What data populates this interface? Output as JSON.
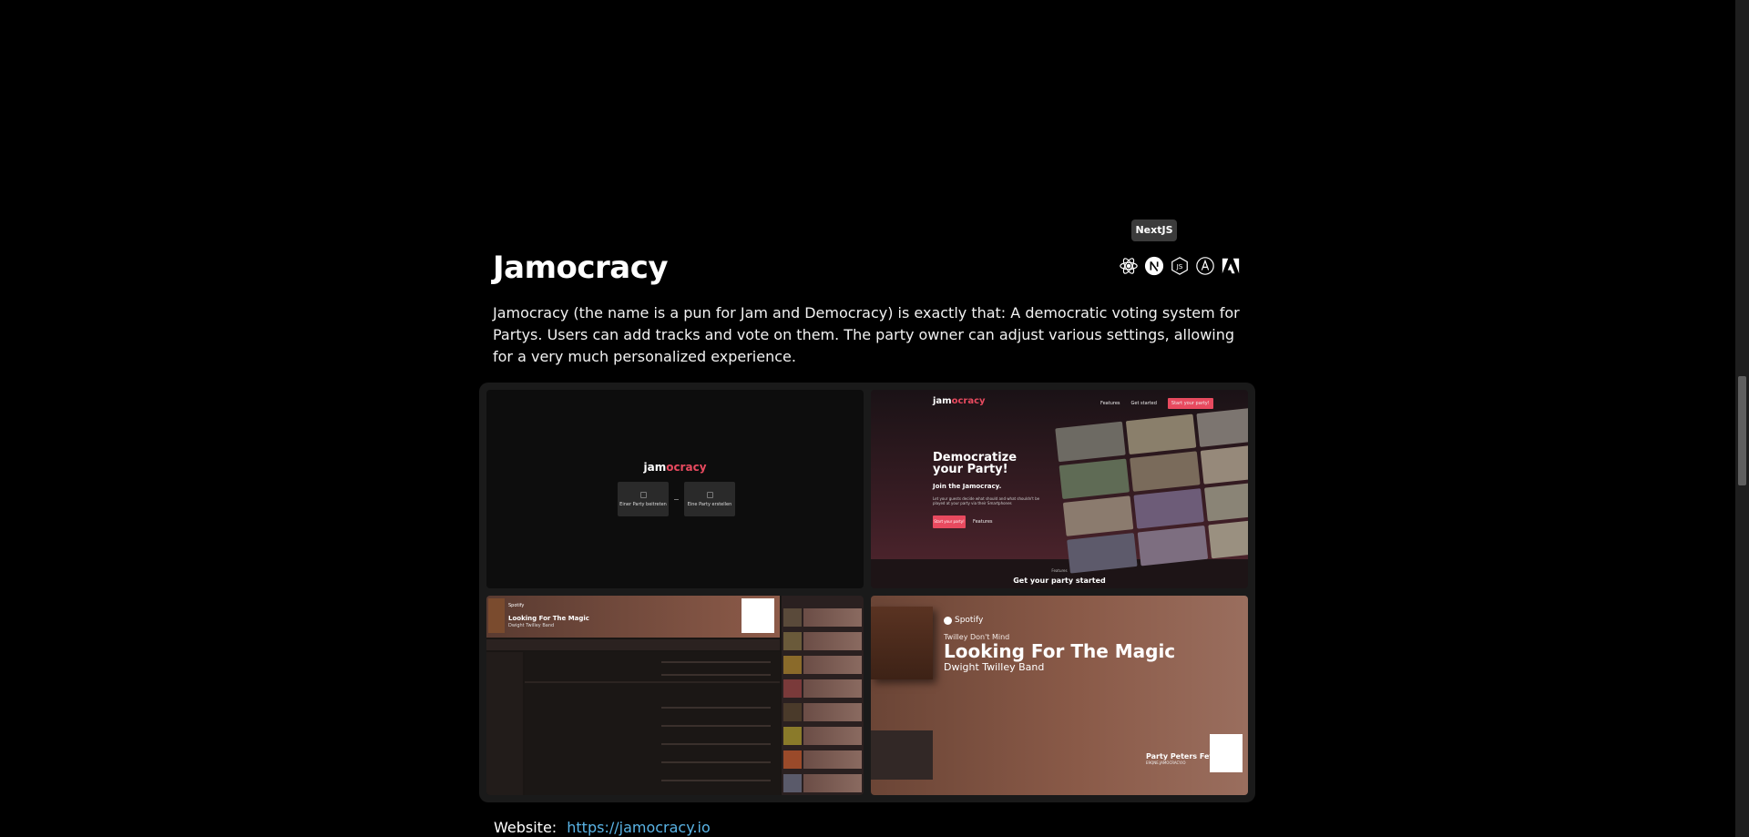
{
  "tooltip": "NextJS",
  "project": {
    "title": "Jamocracy",
    "description": "Jamocracy (the name is a pun for Jam and Democracy) is exactly that: A democratic voting system for Partys. Users can add tracks and vote on them. The party owner can adjust various settings, allowing for a very much personalized experience.",
    "website_label": "Website:",
    "website_url": "https://jamocracy.io"
  },
  "tech_icons": [
    "react-icon",
    "nextjs-icon",
    "nodejs-icon",
    "angular-icon",
    "adobe-icon"
  ],
  "screens": {
    "join": {
      "logo_a": "jam",
      "logo_b": "ocracy",
      "card1": "Einer Party beitreten",
      "card2": "Eine Party erstellen"
    },
    "landing": {
      "logo_a": "jam",
      "logo_b": "ocracy",
      "nav": [
        "Features",
        "Get started",
        "Start your party!"
      ],
      "headline": "Democratize your Party!",
      "subheading": "Join the Jamocracy.",
      "body": "Let your guests decide what should and what shouldn't be played at your party via their Smartphones",
      "cta": "Start your party!",
      "secondary": "Features",
      "bottom_label": "Features",
      "bottom_heading": "Get your party started"
    },
    "dashboard": {
      "provider": "Spotify",
      "song": "Looking For The Magic",
      "artist": "Dwight Twilley Band"
    },
    "player": {
      "provider": "Spotify",
      "album": "Twilley Don't Mind",
      "song": "Looking For The Magic",
      "artist": "Dwight Twilley Band",
      "party_name": "Party Peters Fete",
      "party_code": "E9QNE.JAMOCRACY.IO"
    }
  },
  "colors": {
    "background": "#000000",
    "accent": "#e84a5f",
    "link": "#5ab4e6"
  }
}
